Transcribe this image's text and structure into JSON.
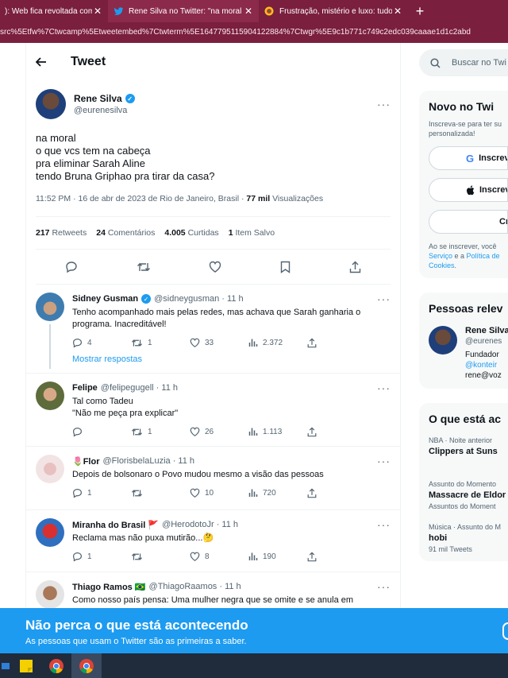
{
  "browser": {
    "tabs": [
      {
        "title": "): Web fica revoltada com a",
        "close": "✕"
      },
      {
        "title": "Rene Silva no Twitter: \"na moral o",
        "close": "✕"
      },
      {
        "title": "Frustração, mistério e luxo: tudo",
        "close": "✕"
      }
    ],
    "new_tab": "+",
    "address": "src%5Etfw%7Ctwcamp%5Etweetembed%7Ctwterm%5E1647795115904122884%7Ctwgr%5E9c1b771c749c2edc039caaae1d1c2abd"
  },
  "header": {
    "title": "Tweet"
  },
  "tweet": {
    "author": {
      "name": "Rene Silva",
      "handle": "@eurenesilva"
    },
    "lines": [
      "na moral",
      "o que vcs tem na cabeça",
      "pra eliminar Sarah Aline",
      "tendo Bruna Griphao pra tirar da casa?"
    ],
    "timestamp": "11:52 PM · 16 de abr de 2023 de Rio de Janeiro, Brasil · ",
    "views_count": "77 mil",
    "views_label": " Visualizações",
    "stats": [
      {
        "count": "217",
        "label": "Retweets"
      },
      {
        "count": "24",
        "label": "Comentários"
      },
      {
        "count": "4.005",
        "label": "Curtidas"
      },
      {
        "count": "1",
        "label": "Item Salvo"
      }
    ]
  },
  "replies": [
    {
      "name": "Sidney Gusman",
      "handle": "@sidneygusman · 11 h",
      "text": "Tenho acompanhado mais pelas redes, mas achava que Sarah ganharia o programa. Inacreditável!",
      "replies": "4",
      "retweets": "1",
      "likes": "33",
      "views": "2.372",
      "show_replies": "Mostrar respostas"
    },
    {
      "name": "Felipe",
      "handle": "@felipegugell · 11 h",
      "text": "Tal como Tadeu\n\"Não me peça pra explicar\"",
      "replies": "",
      "retweets": "1",
      "likes": "26",
      "views": "1.113"
    },
    {
      "name": "🌷Flor",
      "handle": "@FlorisbelaLuzia · 11 h",
      "text": "Depois de bolsonaro  o Povo mudou mesmo a visão  das pessoas",
      "replies": "1",
      "retweets": "",
      "likes": "10",
      "views": "720"
    },
    {
      "name": "Miranha do Brasil 🚩",
      "handle": "@HerodotoJr · 11 h",
      "text": "Reclama mas não puxa mutirão...🤔",
      "replies": "1",
      "retweets": "",
      "likes": "8",
      "views": "190"
    },
    {
      "name": "Thiago Ramos 🇧🇷",
      "handle": "@ThiagoRaamos · 11 h",
      "text": "Como nosso país pensa: Uma mulher negra que se omite e se anula em"
    }
  ],
  "sidebar": {
    "search_placeholder": "Buscar no Twi",
    "signup": {
      "title": "Novo no Twi",
      "subtitle": "Inscreva-se para ter su personalizada!",
      "google": "Inscrev",
      "apple": "Inscrev",
      "create": "Cr",
      "terms_a": "Ao se inscrever, você",
      "terms_link1": "Serviço",
      "terms_mid": " e a ",
      "terms_link2": "Política de",
      "terms_link3": "Cookies",
      "terms_end": "."
    },
    "people": {
      "title": "Pessoas relev",
      "name": "Rene Silva",
      "handle": "@eurenes",
      "bio1": "Fundador",
      "bio2": "@konteir",
      "bio3": "rene@voz"
    },
    "trends": {
      "title": "O que está ac",
      "items": [
        {
          "context": "NBA · Noite anterior",
          "title": "Clippers at Suns",
          "count": ""
        },
        {
          "context": "Assunto do Momento",
          "title": "Massacre de Eldor",
          "count": "Assuntos do Moment"
        },
        {
          "context": "Música · Assunto do M",
          "title": "hobi",
          "count": "91 mil Tweets"
        }
      ]
    }
  },
  "banner": {
    "title": "Não perca o que está acontecendo",
    "subtitle": "As pessoas que usam o Twitter são as primeiras a saber."
  },
  "colors": {
    "twitter_blue": "#1d9bf0",
    "browser_bar": "#7a1f3d",
    "taskbar": "#202b3c"
  }
}
